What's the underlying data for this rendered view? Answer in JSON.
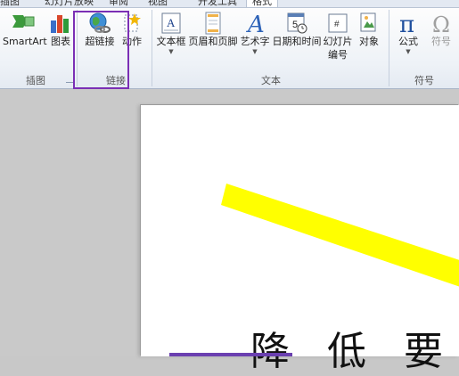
{
  "tabs": [
    "插图",
    "幻灯片放映",
    "审阅",
    "视图",
    "开发工具",
    "格式"
  ],
  "ribbon": {
    "buttons": {
      "smartart": "SmartArt",
      "chart": "图表",
      "hyperlink": "超链接",
      "action": "动作",
      "textbox": "文本框",
      "header_footer": "页眉和页脚",
      "wordart": "艺术字",
      "datetime": "日期和时间",
      "slide_number_line1": "幻灯片",
      "slide_number_line2": "编号",
      "object": "对象",
      "equation": "公式",
      "symbol": "符号"
    },
    "groups": {
      "illustrations": "插图",
      "links": "链接",
      "text": "文本",
      "symbols": "符号"
    }
  },
  "slide": {
    "title_text": "降 低 要"
  },
  "colors": {
    "highlight_border": "#7b2fb5",
    "yellow_shape": "#ffff00"
  }
}
